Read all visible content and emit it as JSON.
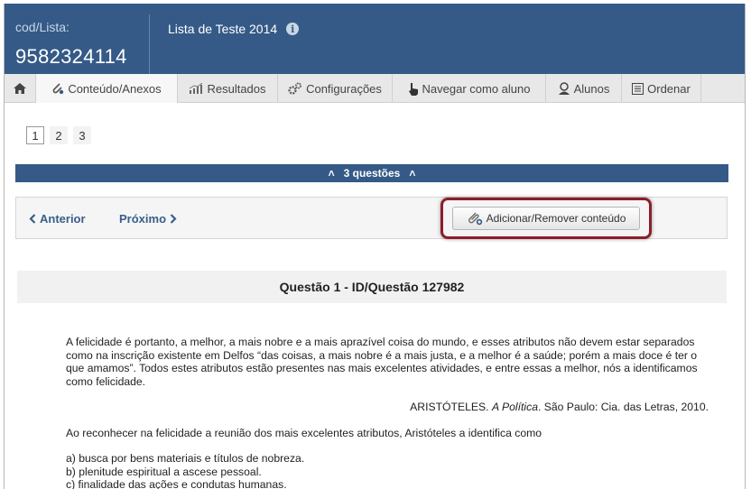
{
  "header": {
    "cod_label": "cod/Lista:",
    "cod_value": "9582324114",
    "list_title": "Lista de Teste 2014",
    "info_icon": "i"
  },
  "tabs": [
    {
      "label": "",
      "icon": "home-icon"
    },
    {
      "label": "Conteúdo/Anexos",
      "icon": "clip-icon",
      "active": true
    },
    {
      "label": "Resultados",
      "icon": "chart-icon"
    },
    {
      "label": "Configurações",
      "icon": "gears-icon"
    },
    {
      "label": "Navegar como aluno",
      "icon": "pointer-icon"
    },
    {
      "label": "Alunos",
      "icon": "user-icon"
    },
    {
      "label": "Ordenar",
      "icon": "list-icon"
    }
  ],
  "pagination": [
    "1",
    "2",
    "3"
  ],
  "questions_bar": "3 questões",
  "nav": {
    "prev": "Anterior",
    "next": "Próximo",
    "content_button": "Adicionar/Remover conteúdo"
  },
  "question": {
    "header": "Questão 1 - ID/Questão 127982",
    "paragraph": "A felicidade é portanto, a melhor, a mais nobre e a mais aprazível coisa do mundo, e esses atributos não devem estar separados como na inscrição existente em Delfos “das coisas, a mais nobre é a mais justa, e a melhor é a saúde; porém a mais doce é ter o que amamos”. Todos estes atributos estão presentes nas mais excelentes atividades, e entre essas a melhor, nós a identificamos como felicidade.",
    "citation_author": "ARISTÓTELES.",
    "citation_title": "A Política",
    "citation_rest": ". São Paulo: Cia. das Letras, 2010.",
    "prompt": "Ao reconhecer na felicidade a reunião dos mais excelentes atributos, Aristóteles a identifica como",
    "options": [
      "a) busca por bens materiais e títulos de nobreza.",
      "b) plenitude espiritual a ascese pessoal.",
      "c) finalidade das ações e condutas humanas."
    ]
  },
  "colors": {
    "header_bg": "#355a87",
    "highlight_border": "#8b1f2a",
    "link": "#3a5d8a"
  }
}
